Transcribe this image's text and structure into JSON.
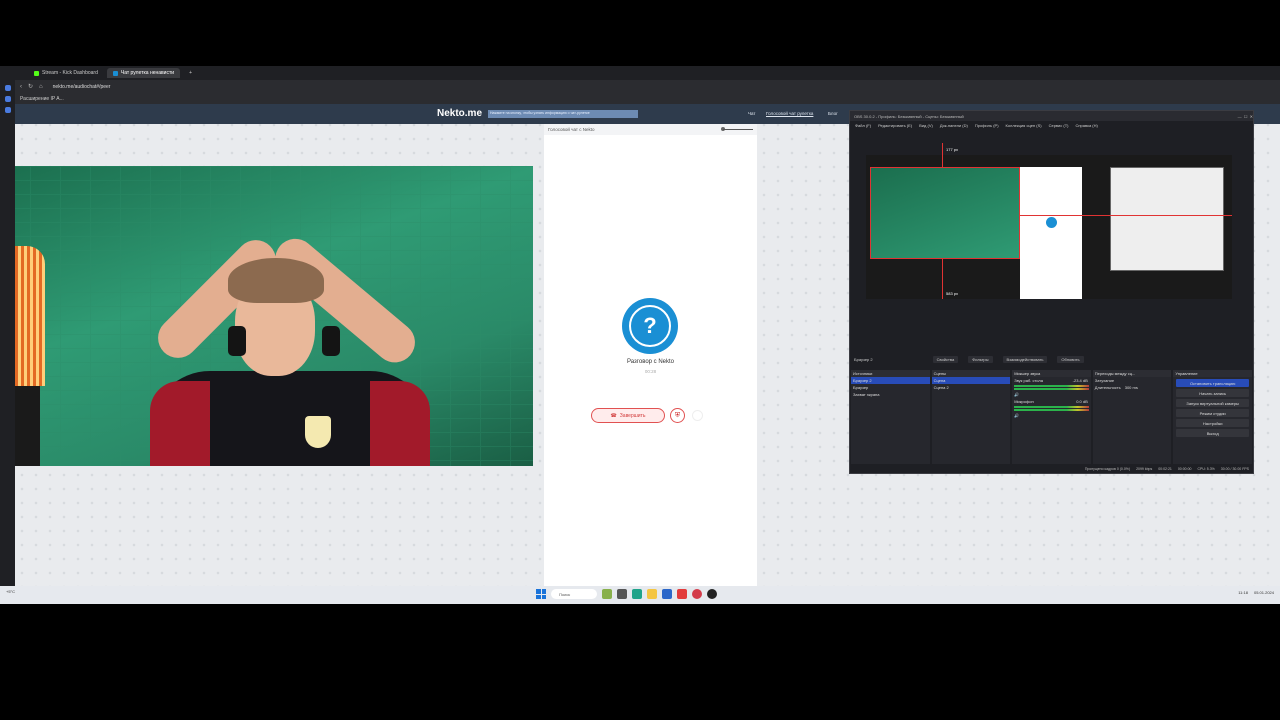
{
  "browser": {
    "tabs": [
      {
        "label": "Stream - Kick Dashboard",
        "active": false,
        "color": "#53fc18"
      },
      {
        "label": "Чат рулетка ненависти",
        "active": true,
        "color": "#1a8fd4"
      }
    ],
    "url": "nekto.me/audiochat#/peer",
    "bookmark": "Расширение IP A..."
  },
  "nekto": {
    "logo": "Nekto.me",
    "notice": "Нажмите на кнопку, чтобы узнать информацию о чат-рулетке",
    "links": [
      "Чат",
      "Голосовой чат рулетка",
      "Блог"
    ],
    "chat_title": "Голосовой чат с Nekto",
    "conversation_label": "Разговор с Nekto",
    "timer": "00:28",
    "end_button": "Завершить"
  },
  "obs": {
    "title": "OBS 30.0.2 - Профиль: Безымянный - Сцены: Безымянный",
    "menu": [
      "Файл (F)",
      "Редактировать (E)",
      "Вид (V)",
      "Док-панели (D)",
      "Профиль (P)",
      "Коллекция сцен (S)",
      "Сервис (T)",
      "Справка (H)"
    ],
    "preview_top_label": "177 px",
    "preview_bottom_label": "583 px",
    "source_label": "Браузер 2",
    "toolbar": [
      "Свойства",
      "Фильтры",
      "Взаимодействовать",
      "Обновить"
    ],
    "docks": {
      "sources": {
        "title": "Источники",
        "items": [
          "Браузер 2",
          "Браузер",
          "Захват экрана"
        ]
      },
      "scenes": {
        "title": "Сцены",
        "items": [
          "Сцена",
          "Сцена 2"
        ]
      },
      "mixer": {
        "title": "Микшер звука",
        "items": [
          {
            "name": "Звук раб. стола",
            "db": "-23.4 dB"
          },
          {
            "name": "Микрофон",
            "db": "0.0 dB"
          }
        ]
      },
      "transitions": {
        "title": "Переходы между сц...",
        "type": "Затухание",
        "duration_label": "Длительность",
        "duration": "300 ms"
      },
      "controls": {
        "title": "Управление",
        "buttons": [
          "Остановить трансляцию",
          "Начать запись",
          "Запуск виртуальной камеры",
          "Режим студии",
          "Настройки",
          "Выход"
        ]
      }
    },
    "status": [
      "Пропущено кадров 0 (0.0%)",
      "2099 kbps",
      "00:02:21",
      "00:00:00",
      "CPU: 5.3%",
      "30.00 / 30.00 FPS"
    ]
  },
  "taskbar": {
    "weather": "+5°C",
    "search": "Поиск",
    "time": "11:18",
    "date": "05.01.2024"
  }
}
